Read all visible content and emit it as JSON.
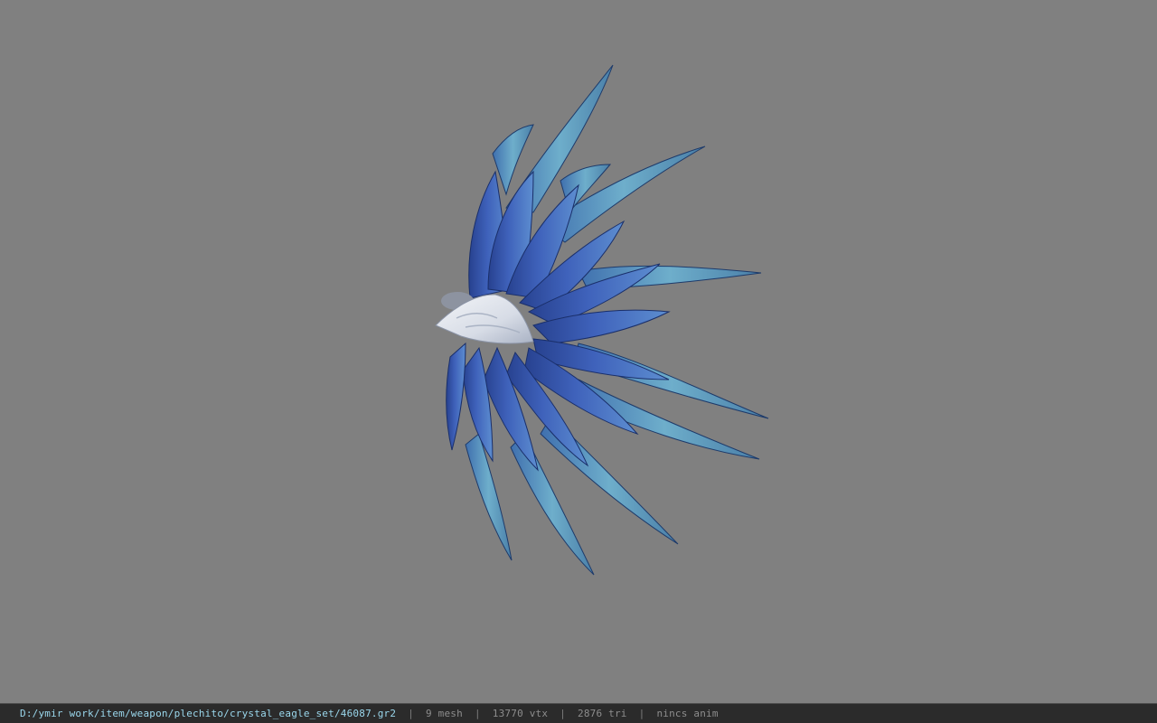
{
  "viewer": {
    "background_color": "#808080",
    "model": {
      "description_icon": "crystal-eagle-wing-model",
      "palette": {
        "feather_dark": "#2e4a9a",
        "feather_mid": "#4a6cc4",
        "feather_light": "#6fa8c8",
        "tip_light": "#a8d8e8",
        "head": "#dfe4ec"
      }
    }
  },
  "status_bar": {
    "file_path": "D:/ymir work/item/weapon/plechito/crystal_eagle_set/46087.gr2",
    "separator": "|",
    "mesh": "9 mesh",
    "vtx": "13770 vtx",
    "tri": "2876 tri",
    "anim": "nincs anim"
  }
}
